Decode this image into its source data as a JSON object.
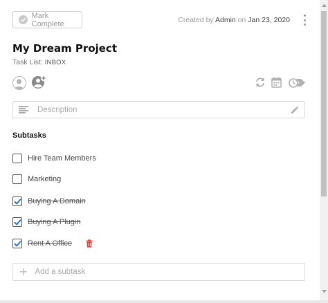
{
  "header": {
    "mark_complete_label": "Mark Complete",
    "created_prefix": "Created by ",
    "created_by": "Admin",
    "created_on_word": " on ",
    "created_date": "Jan 23, 2020"
  },
  "task": {
    "title": "My Dream Project",
    "task_list_label": "Task List: ",
    "task_list_value": "INBOX"
  },
  "icons": {
    "avatar": "user-avatar-icon",
    "add_user": "add-user-icon",
    "repeat": "repeat-icon",
    "calendar": "calendar-icon",
    "tags": "clock-tag-icon",
    "pencil": "pencil-icon",
    "trash": "trash-icon"
  },
  "description": {
    "placeholder": "Description"
  },
  "subtasks": {
    "heading": "Subtasks",
    "items": [
      {
        "label": "Hire Team Members",
        "checked": false
      },
      {
        "label": "Marketing",
        "checked": false
      },
      {
        "label": "Buying A Domain",
        "checked": true
      },
      {
        "label": "Buying A Plugin",
        "checked": true
      },
      {
        "label": "Rent A Office",
        "checked": true
      }
    ],
    "add_placeholder": "Add a subtask"
  },
  "colors": {
    "check_blue": "#1a73c9",
    "trash_red": "#e0403d",
    "muted_gray": "#9a9a9a"
  }
}
